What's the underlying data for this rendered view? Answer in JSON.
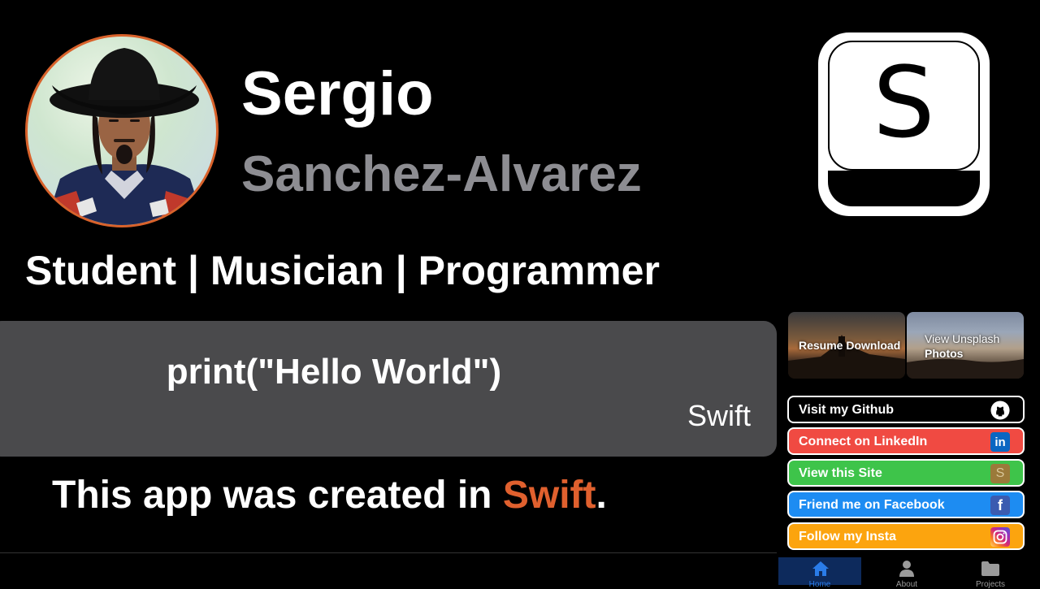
{
  "profile": {
    "first_name": "Sergio",
    "last_name": "Sanchez-Alvarez",
    "tagline": "Student | Musician | Programmer"
  },
  "app_logo": {
    "letter": "S"
  },
  "code_box": {
    "code": "print(\"Hello World\")",
    "language": "Swift"
  },
  "created": {
    "prefix": "This app was created in ",
    "accent": "Swift",
    "suffix": "."
  },
  "cards": {
    "resume": "Resume Download",
    "unsplash_line1": "View Unsplash",
    "unsplash_line2": "Photos"
  },
  "links": [
    {
      "label": "Visit my Github",
      "icon": "github-icon",
      "color": "#000000"
    },
    {
      "label": "Connect on LinkedIn",
      "icon": "linkedin-icon",
      "color": "#f04a42"
    },
    {
      "label": "View this Site",
      "icon": "site-icon",
      "color": "#3ec44a"
    },
    {
      "label": "Friend me on Facebook",
      "icon": "facebook-icon",
      "color": "#1d8cf2"
    },
    {
      "label": "Follow my Insta",
      "icon": "instagram-icon",
      "color": "#fca40e"
    }
  ],
  "tabs": [
    {
      "label": "Home",
      "icon": "home-icon",
      "active": true
    },
    {
      "label": "About",
      "icon": "person-icon",
      "active": false
    },
    {
      "label": "Projects",
      "icon": "folder-icon",
      "active": false
    }
  ],
  "colors": {
    "accent": "#e0602e",
    "secondary_text": "#8d8d92",
    "code_bg": "#4a4a4c",
    "tab_active": "#2a7ce8"
  }
}
